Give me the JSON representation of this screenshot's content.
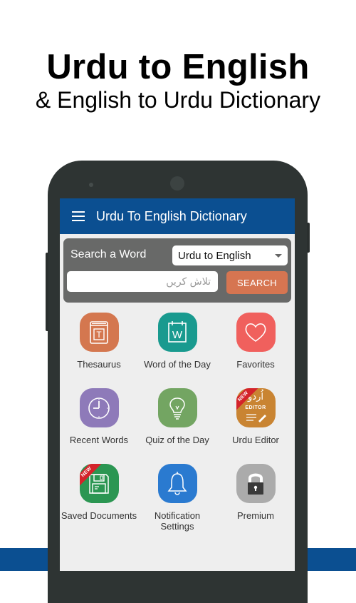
{
  "promo": {
    "title": "Urdu to English",
    "subtitle": "& English to Urdu Dictionary"
  },
  "appbar": {
    "title": "Urdu To English Dictionary",
    "menu_icon": "hamburger-menu-icon"
  },
  "search": {
    "label": "Search a Word",
    "language_selected": "Urdu to English",
    "input_value": "",
    "input_placeholder": "تلاش کریں",
    "button_label": "SEARCH"
  },
  "features": [
    {
      "label": "Thesaurus",
      "icon": "book-icon",
      "color": "#d4774f",
      "badge": ""
    },
    {
      "label": "Word of the Day",
      "icon": "calendar-icon",
      "color": "#199a8f",
      "badge": ""
    },
    {
      "label": "Favorites",
      "icon": "heart-icon",
      "color": "#f0605d",
      "badge": ""
    },
    {
      "label": "Recent Words",
      "icon": "clock-icon",
      "color": "#8e7ab9",
      "badge": ""
    },
    {
      "label": "Quiz of the Day",
      "icon": "lightbulb-icon",
      "color": "#73a562",
      "badge": ""
    },
    {
      "label": "Urdu Editor",
      "icon": "urdu-editor-icon",
      "color": "#c98432",
      "badge": "NEW",
      "icon_text_urdu": "اُردو",
      "icon_text_editor": "EDITOR"
    },
    {
      "label": "Saved Documents",
      "icon": "floppy-disk-icon",
      "color": "#2b9652",
      "badge": "NEW"
    },
    {
      "label": "Notification Settings",
      "icon": "bell-icon",
      "color": "#2a7ad0",
      "badge": ""
    },
    {
      "label": "Premium",
      "icon": "lock-icon",
      "color": "#ababab",
      "badge": ""
    }
  ],
  "colors": {
    "brand_blue": "#0b4f91",
    "search_button": "#d67551",
    "search_card": "#686968"
  }
}
